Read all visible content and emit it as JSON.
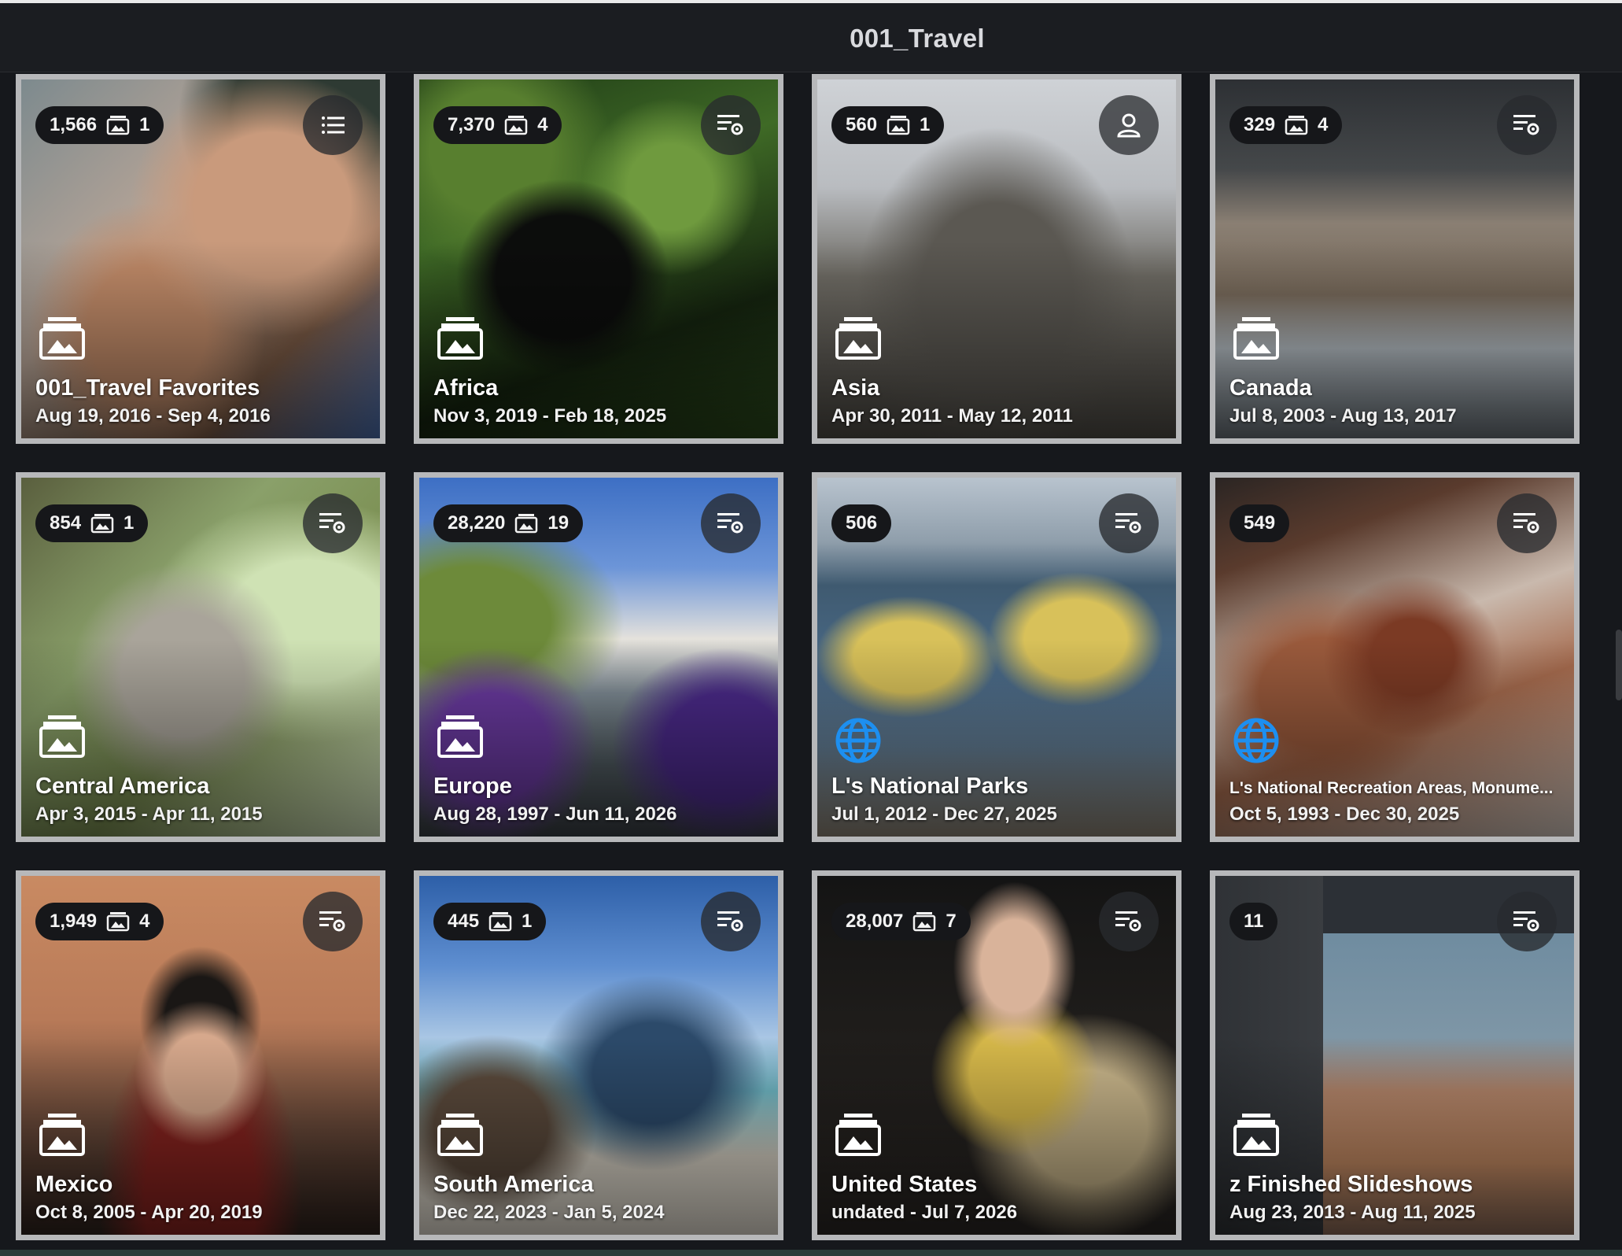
{
  "header": {
    "title": "001_Travel"
  },
  "colors": {
    "background": "#16181c",
    "card_border": "#b7b8ba",
    "globe_blue": "#1d8ff0"
  },
  "albums": [
    {
      "count": "1,566",
      "sub_count": "1",
      "action_icon": "list-icon",
      "type_icon": "album-icon",
      "title": "001_Travel Favorites",
      "dates": "Aug 19, 2016 - Sep 4, 2016"
    },
    {
      "count": "7,370",
      "sub_count": "4",
      "action_icon": "filter-settings-icon",
      "type_icon": "album-icon",
      "title": "Africa",
      "dates": "Nov 3, 2019 - Feb 18, 2025"
    },
    {
      "count": "560",
      "sub_count": "1",
      "action_icon": "person-icon",
      "type_icon": "album-icon",
      "title": "Asia",
      "dates": "Apr 30, 2011 - May 12, 2011"
    },
    {
      "count": "329",
      "sub_count": "4",
      "action_icon": "filter-settings-icon",
      "type_icon": "album-icon",
      "title": "Canada",
      "dates": "Jul 8, 2003 - Aug 13, 2017"
    },
    {
      "count": "854",
      "sub_count": "1",
      "action_icon": "filter-settings-icon",
      "type_icon": "album-icon",
      "title": "Central America",
      "dates": "Apr 3, 2015 - Apr 11, 2015"
    },
    {
      "count": "28,220",
      "sub_count": "19",
      "action_icon": "filter-settings-icon",
      "type_icon": "album-icon",
      "title": "Europe",
      "dates": "Aug 28, 1997 - Jun 11, 2026"
    },
    {
      "count": "506",
      "sub_count": "",
      "action_icon": "filter-settings-icon",
      "type_icon": "globe-icon",
      "title": "L's National Parks",
      "dates": "Jul 1, 2012 - Dec 27, 2025"
    },
    {
      "count": "549",
      "sub_count": "",
      "action_icon": "filter-settings-icon",
      "type_icon": "globe-icon",
      "title": "L's National Recreation Areas, Monume...",
      "dates": "Oct 5, 1993 - Dec 30, 2025"
    },
    {
      "count": "1,949",
      "sub_count": "4",
      "action_icon": "filter-settings-icon",
      "type_icon": "album-icon",
      "title": "Mexico",
      "dates": "Oct 8, 2005 - Apr 20, 2019"
    },
    {
      "count": "445",
      "sub_count": "1",
      "action_icon": "filter-settings-icon",
      "type_icon": "album-icon",
      "title": "South America",
      "dates": "Dec 22, 2023 - Jan 5, 2024"
    },
    {
      "count": "28,007",
      "sub_count": "7",
      "action_icon": "filter-settings-icon",
      "type_icon": "album-icon",
      "title": "United States",
      "dates": "undated - Jul 7, 2026"
    },
    {
      "count": "11",
      "sub_count": "",
      "action_icon": "filter-settings-icon",
      "type_icon": "album-icon",
      "title": "z Finished Slideshows",
      "dates": "Aug 23, 2013 - Aug 11, 2025"
    }
  ]
}
